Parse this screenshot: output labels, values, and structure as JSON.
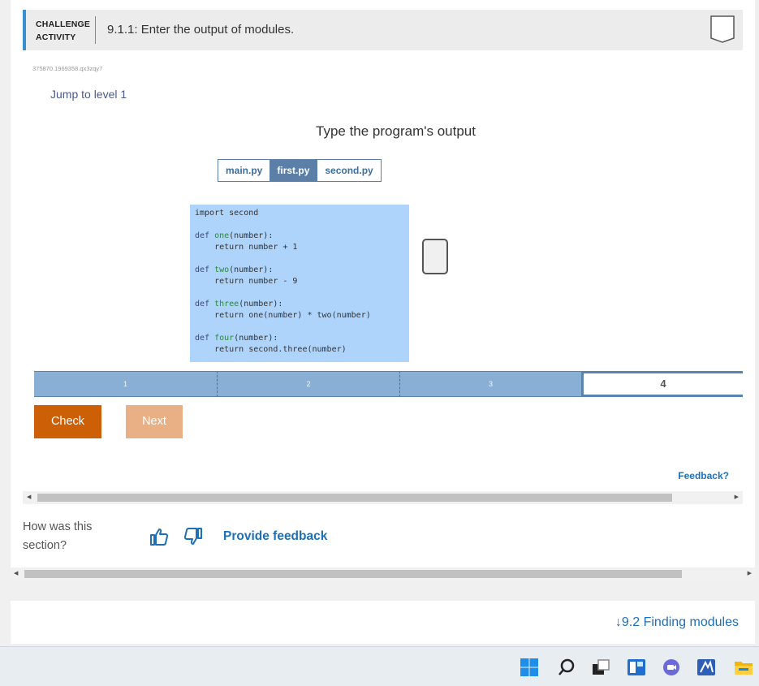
{
  "header": {
    "label_line1": "CHALLENGE",
    "label_line2": "ACTIVITY",
    "title": "9.1.1: Enter the output of modules."
  },
  "activity_id": "375870.1969358.qx3zqy7",
  "jump_to_level": "Jump to level 1",
  "prompt": "Type the program's output",
  "file_tabs": [
    {
      "label": "main.py"
    },
    {
      "label": "first.py",
      "active": true
    },
    {
      "label": "second.py"
    }
  ],
  "code_lines": {
    "l1": "import second",
    "l2": "def one(number):",
    "l3": "    return number + 1",
    "l4": "def two(number):",
    "l5": "    return number - 9",
    "l6": "def three(number):",
    "l7": "    return one(number) * two(number)",
    "l8": "def four(number):",
    "l9": "    return second.three(number)"
  },
  "levels": [
    "1",
    "2",
    "3",
    "4"
  ],
  "current_level": "4",
  "buttons": {
    "check": "Check",
    "next": "Next"
  },
  "feedback_link": "Feedback?",
  "rating": {
    "question": "How was this section?",
    "provide": "Provide feedback"
  },
  "next_section": "9.2 Finding modules",
  "colors": {
    "accent": "#1f6fb6",
    "check": "#cd5f06",
    "next": "#e8b084",
    "code_bg": "#aed4fb",
    "level_fill": "#8aafd4"
  },
  "taskbar_icons": [
    "windows-start-icon",
    "search-icon",
    "task-view-icon",
    "widgets-icon",
    "chat-icon",
    "app-icon",
    "file-explorer-icon"
  ]
}
